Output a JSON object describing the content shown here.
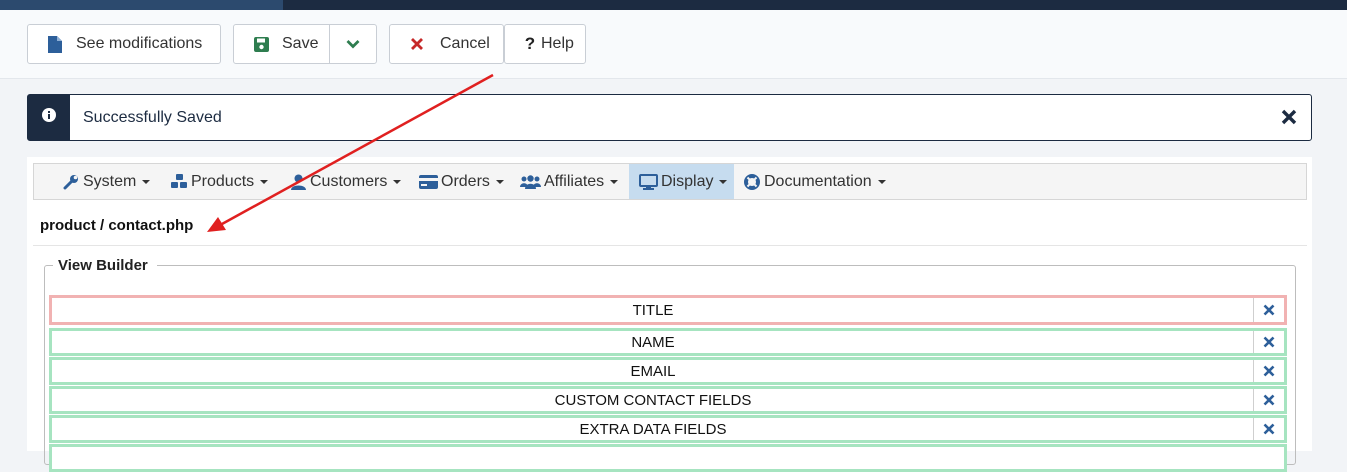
{
  "toolbar": {
    "see_modifications_label": "See modifications",
    "save_label": "Save",
    "cancel_label": "Cancel",
    "help_label": "Help"
  },
  "alert": {
    "message": "Successfully Saved"
  },
  "menu": {
    "items": [
      {
        "label": "System",
        "icon": "wrench-icon"
      },
      {
        "label": "Products",
        "icon": "cubes-icon"
      },
      {
        "label": "Customers",
        "icon": "user-icon"
      },
      {
        "label": "Orders",
        "icon": "credit-card-icon"
      },
      {
        "label": "Affiliates",
        "icon": "users-icon"
      },
      {
        "label": "Display",
        "icon": "monitor-icon",
        "active": true
      },
      {
        "label": "Documentation",
        "icon": "life-ring-icon"
      }
    ]
  },
  "file_path": "product / contact.php",
  "view_builder": {
    "legend": "View Builder",
    "rows": [
      {
        "label": "TITLE"
      },
      {
        "label": "NAME"
      },
      {
        "label": "EMAIL"
      },
      {
        "label": "CUSTOM CONTACT FIELDS"
      },
      {
        "label": "EXTRA DATA FIELDS"
      }
    ]
  },
  "colors": {
    "navy": "#1c2b41",
    "accent_blue": "#2d5f9a",
    "save_green": "#2e7d4f",
    "cancel_red": "#c62828",
    "row_green_border": "#a6e4c0",
    "row_red_border": "#f1b2b2",
    "active_menu_bg": "#c6dcef",
    "annotation_arrow": "#e02020"
  }
}
